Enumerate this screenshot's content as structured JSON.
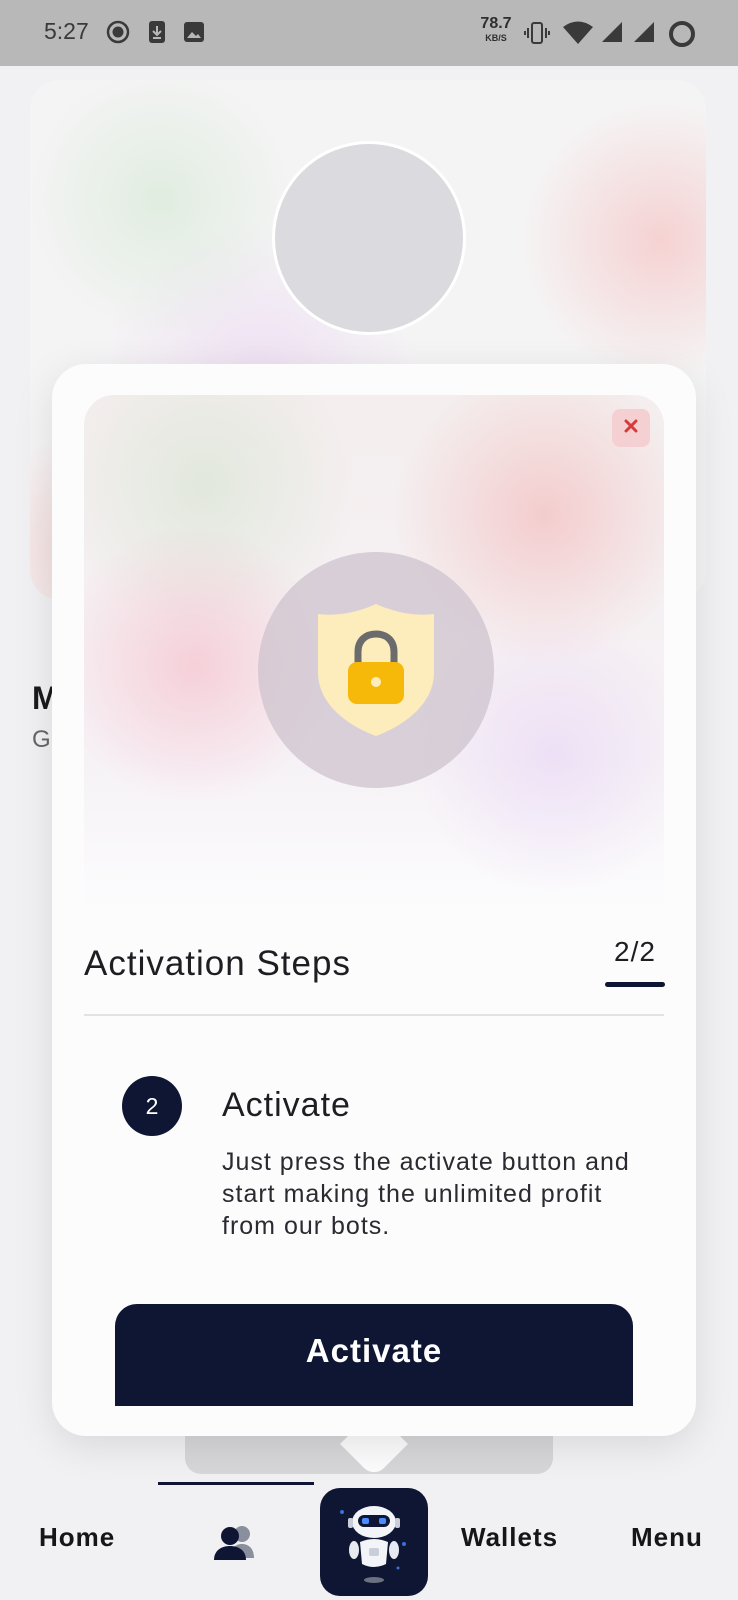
{
  "status_bar": {
    "time": "5:27",
    "net_speed_value": "78.7",
    "net_speed_unit": "KB/S",
    "icons": [
      "record-icon",
      "download-icon",
      "image-icon",
      "vibrate-icon",
      "wifi-icon",
      "signal-icon",
      "signal-icon",
      "battery-ring-icon"
    ]
  },
  "background_page": {
    "title_fragment": "M",
    "subtitle_fragment": "G"
  },
  "modal": {
    "close_icon": "close-icon",
    "hero_icon": "shield-lock-icon",
    "steps_title": "Activation Steps",
    "steps_count": "2/2",
    "step": {
      "number": "2",
      "title": "Activate",
      "description": "Just press the activate button and start making the unlimited profit from our bots."
    },
    "activate_label": "Activate"
  },
  "bottom_nav": {
    "home_label": "Home",
    "users_icon": "users-icon",
    "bot_icon": "robot-icon",
    "wallets_label": "Wallets",
    "menu_label": "Menu"
  },
  "colors": {
    "navy": "#0e1634",
    "shield": "#fdedbd",
    "lock": "#f6b90a",
    "close_bg": "#f5d0d3",
    "close_x": "#d83a3a"
  }
}
